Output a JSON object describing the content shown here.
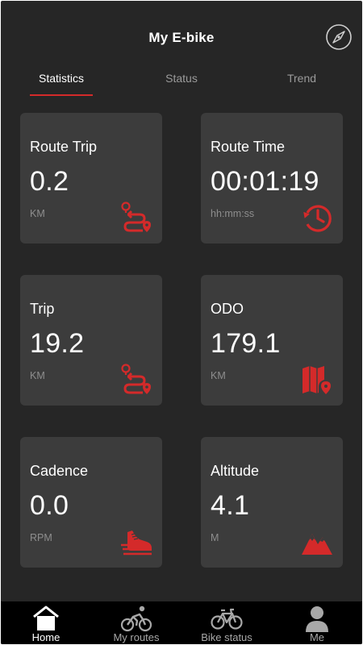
{
  "header": {
    "title": "My E-bike",
    "compass_icon": "compass-icon"
  },
  "tabs": [
    {
      "label": "Statistics",
      "active": true
    },
    {
      "label": "Status",
      "active": false
    },
    {
      "label": "Trend",
      "active": false
    }
  ],
  "cards": [
    {
      "label": "Route Trip",
      "value": "0.2",
      "unit": "KM",
      "icon": "route-icon"
    },
    {
      "label": "Route Time",
      "value": "00:01:19",
      "unit": "hh:mm:ss",
      "icon": "history-clock-icon"
    },
    {
      "label": "Trip",
      "value": "19.2",
      "unit": "KM",
      "icon": "route-icon"
    },
    {
      "label": "ODO",
      "value": "179.1",
      "unit": "KM",
      "icon": "map-pin-icon"
    },
    {
      "label": "Cadence",
      "value": "0.0",
      "unit": "RPM",
      "icon": "shoe-speed-icon"
    },
    {
      "label": "Altitude",
      "value": "4.1",
      "unit": "M",
      "icon": "mountain-icon"
    }
  ],
  "nav": [
    {
      "label": "Home",
      "icon": "home-icon",
      "active": true
    },
    {
      "label": "My routes",
      "icon": "cyclist-icon",
      "active": false
    },
    {
      "label": "Bike status",
      "icon": "bike-icon",
      "active": false
    },
    {
      "label": "Me",
      "icon": "person-icon",
      "active": false
    }
  ],
  "colors": {
    "background": "#262626",
    "card": "#3c3c3c",
    "accent": "#d42a2a",
    "nav_background": "#000000"
  }
}
